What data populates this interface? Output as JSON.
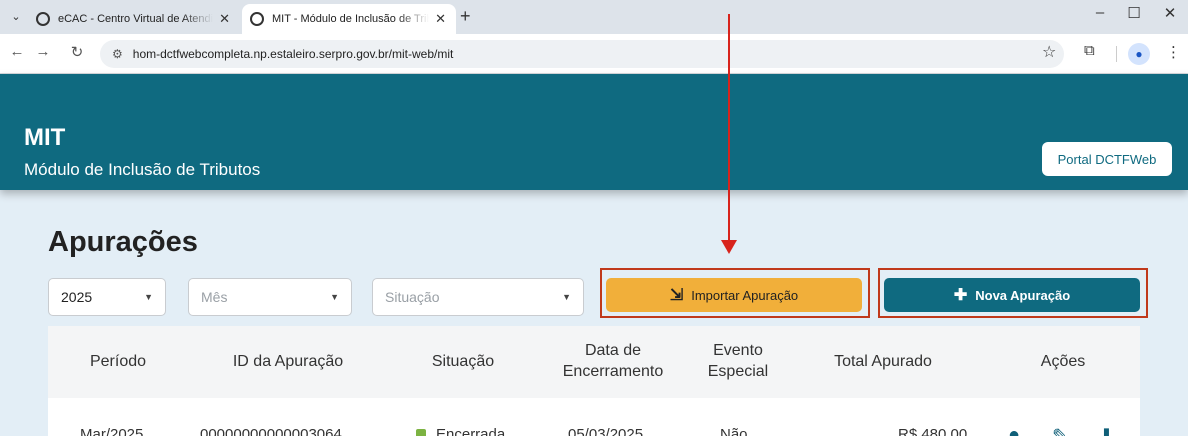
{
  "browser": {
    "tabs": [
      {
        "title": "eCAC - Centro Virtual de Atendimento"
      },
      {
        "title": "MIT - Módulo de Inclusão de Tributos"
      }
    ],
    "url": "hom-dctfwebcompleta.np.estaleiro.serpro.gov.br/mit-web/mit"
  },
  "header": {
    "title": "MIT",
    "subtitle": "Módulo de Inclusão de Tributos",
    "portal_button": "Portal DCTFWeb"
  },
  "page": {
    "title": "Apurações",
    "filters": {
      "year": "2025",
      "month_placeholder": "Mês",
      "status_placeholder": "Situação"
    },
    "import_button": "Importar Apuração",
    "new_button": "Nova Apuração"
  },
  "table": {
    "headers": {
      "period": "Período",
      "id": "ID da Apuração",
      "status": "Situação",
      "closing_date": "Data de Encerramento",
      "special_event": "Evento Especial",
      "total": "Total Apurado",
      "actions": "Ações"
    },
    "rows": [
      {
        "period": "Mar/2025",
        "id": "00000000000003064",
        "status": "Encerrada",
        "closing_date": "05/03/2025",
        "special_event": "Não",
        "total": "R$ 480,00"
      }
    ]
  },
  "colors": {
    "header_bg": "#0f6a80",
    "import_button_bg": "#f1af3a",
    "highlight_border": "#c0391b",
    "arrow": "#d8231c"
  }
}
